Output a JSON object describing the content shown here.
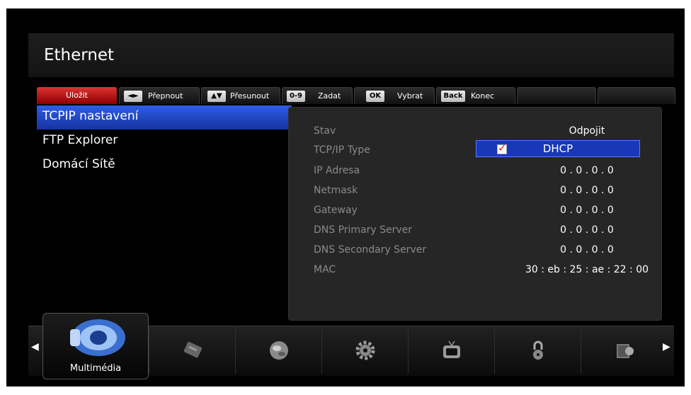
{
  "header": {
    "title": "Ethernet"
  },
  "keybar": {
    "save": "Uložit",
    "keys": [
      {
        "key": "◄►",
        "label": "Přepnout"
      },
      {
        "key": "▲▼",
        "label": "Přesunout"
      },
      {
        "key": "0-9",
        "label": "Zadat"
      },
      {
        "key": "OK",
        "label": "Vybrat"
      },
      {
        "key": "Back",
        "label": "Konec"
      }
    ]
  },
  "menu": {
    "items": [
      {
        "label": "TCPIP nastavení",
        "active": true
      },
      {
        "label": "FTP Explorer"
      },
      {
        "label": "Domácí Sítě"
      }
    ]
  },
  "settings": {
    "rows": [
      {
        "label": "Stav",
        "value": "Odpojit"
      },
      {
        "label": "TCP/IP Type",
        "value": "DHCP",
        "checked": true
      },
      {
        "label": "IP Adresa",
        "value": "0 . 0 . 0 . 0"
      },
      {
        "label": "Netmask",
        "value": "0 . 0 . 0 . 0"
      },
      {
        "label": "Gateway",
        "value": "0 . 0 . 0 . 0"
      },
      {
        "label": "DNS Primary Server",
        "value": "0 . 0 . 0 . 0"
      },
      {
        "label": "DNS Secondary Server",
        "value": "0 . 0 . 0 . 0"
      },
      {
        "label": "MAC",
        "value": "30 : eb : 25 : ae : 22 : 00"
      }
    ]
  },
  "dock": {
    "active_label": "Multimédia",
    "icons": [
      "multimedia-icon",
      "card-icon",
      "globe-icon",
      "gear-icon",
      "tv-icon",
      "lock-icon",
      "book-icon"
    ]
  }
}
